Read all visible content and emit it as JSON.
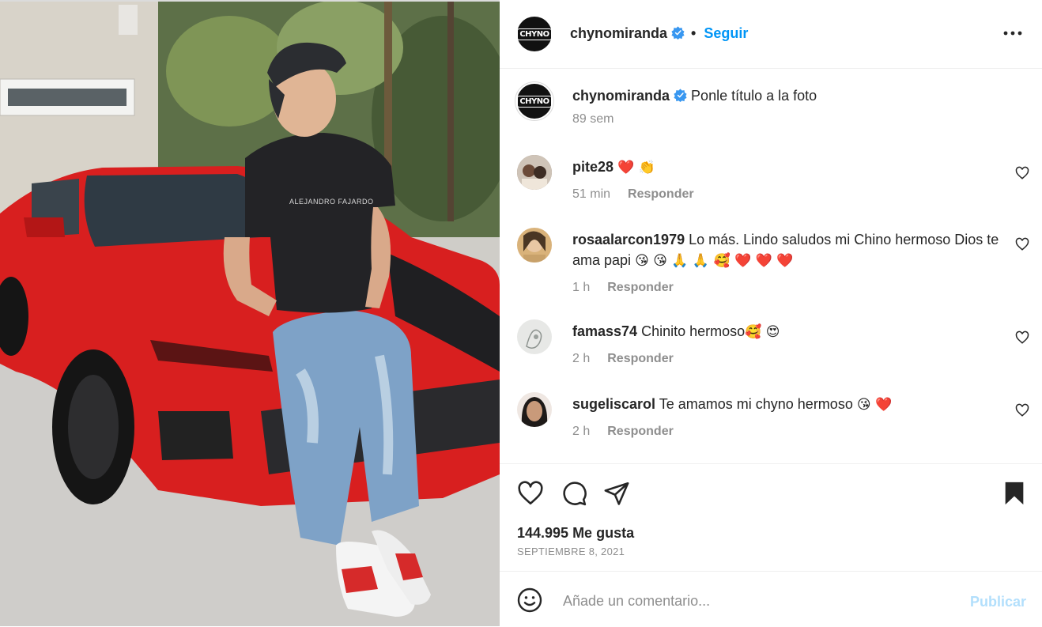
{
  "post": {
    "username": "chynomiranda",
    "logo_text": "CHYNO",
    "follow_label": "Seguir",
    "dot": "•",
    "caption": "Ponle título a la foto",
    "caption_time": "89 sem",
    "shirt_text": "ALEJANDRO FAJARDO"
  },
  "comments": [
    {
      "user": "pite28",
      "text": "",
      "emoji": "❤️ 👏",
      "time": "51 min",
      "reply": "Responder"
    },
    {
      "user": "rosaalarcon1979",
      "text": "Lo más. Lindo saludos mi Chino hermoso Dios te ama papi",
      "emoji": "😘 😘 🙏 🙏 🥰 ❤️ ❤️ ❤️",
      "time": "1 h",
      "reply": "Responder"
    },
    {
      "user": "famass74",
      "text": "Chinito hermoso",
      "emoji": "🥰 😍",
      "time": "2 h",
      "reply": "Responder"
    },
    {
      "user": "sugeliscarol",
      "text": "Te amamos mi chyno hermoso",
      "emoji": "😘 ❤️",
      "time": "2 h",
      "reply": "Responder"
    }
  ],
  "stats": {
    "likes": "144.995 Me gusta",
    "date": "SEPTIEMBRE 8, 2021"
  },
  "composer": {
    "placeholder": "Añade un comentario...",
    "publish": "Publicar"
  },
  "icons": {
    "like": "heart-icon",
    "comment": "comment-icon",
    "share": "paper-plane-icon",
    "save": "bookmark-icon",
    "more": "more-horizontal-icon",
    "emoji": "emoji-icon"
  },
  "colors": {
    "accent": "#0095f6",
    "publish_disabled": "#b2dffc",
    "secondary_text": "#8e8e8e"
  }
}
